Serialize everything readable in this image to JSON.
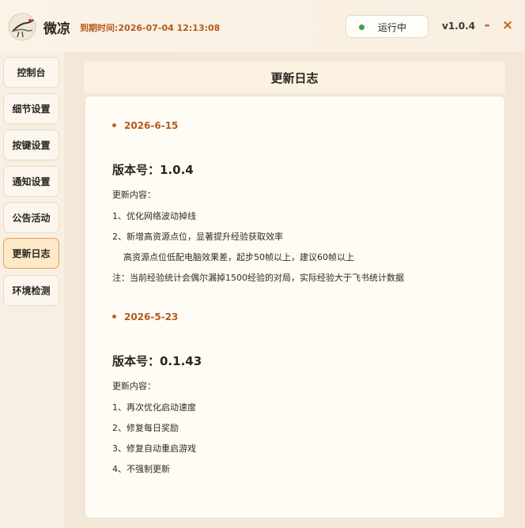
{
  "app": {
    "name": "微凉",
    "expire_label": "到期时间:2026-07-04 12:13:08",
    "status": "运行中",
    "version": "v1.0.4",
    "minimize": "-",
    "close": "×"
  },
  "sidebar": {
    "items": [
      {
        "label": "控制台"
      },
      {
        "label": "细节设置"
      },
      {
        "label": "按键设置"
      },
      {
        "label": "通知设置"
      },
      {
        "label": "公告活动"
      },
      {
        "label": "更新日志",
        "active": true
      },
      {
        "label": "环境检测"
      }
    ]
  },
  "panel": {
    "title": "更新日志",
    "entries": [
      {
        "date": "2026-6-15",
        "version": "版本号：1.0.4",
        "lines": [
          "更新内容：",
          "1、优化网络波动掉线",
          "2、新增高资源点位，显著提升经验获取效率",
          "    高资源点位低配电脑效果差，起步50帧以上，建议60帧以上",
          "注：当前经验统计会偶尔漏掉1500经验的对局，实际经验大于飞书统计数据"
        ]
      },
      {
        "date": "2026-5-23",
        "version": "版本号：0.1.43",
        "lines": [
          "更新内容：",
          "1、再次优化启动速度",
          "2、修复每日奖励",
          "3、修复自动重启游戏",
          "4、不强制更新"
        ]
      }
    ]
  },
  "colors": {
    "accent": "#c4631c",
    "status_dot": "#3aa14a",
    "active_nav_bg": "#fde8c7",
    "active_nav_border": "#e7a24f"
  }
}
